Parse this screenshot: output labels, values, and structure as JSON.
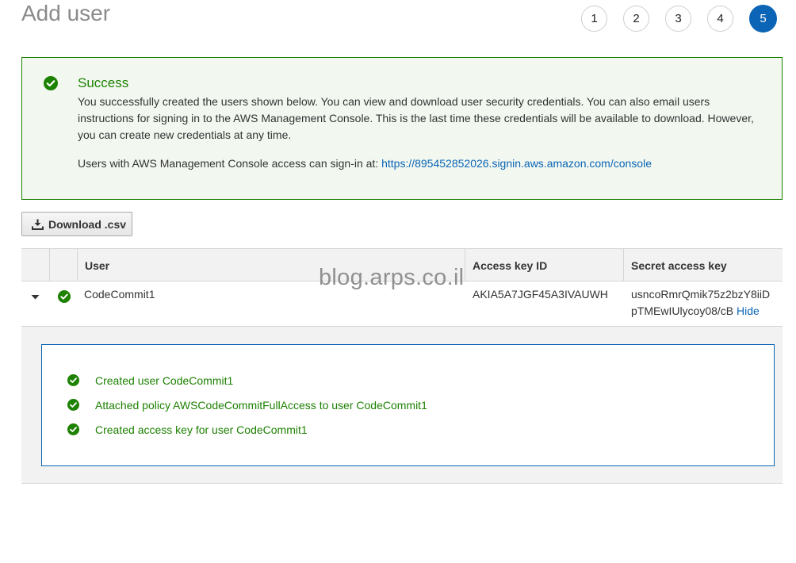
{
  "page": {
    "title": "Add user"
  },
  "steps": [
    {
      "label": "1",
      "active": false
    },
    {
      "label": "2",
      "active": false
    },
    {
      "label": "3",
      "active": false
    },
    {
      "label": "4",
      "active": false
    },
    {
      "label": "5",
      "active": true
    }
  ],
  "success": {
    "title": "Success",
    "message": "You successfully created the users shown below. You can view and download user security credentials. You can also email users instructions for signing in to the AWS Management Console. This is the last time these credentials will be available to download. However, you can create new credentials at any time.",
    "signin_prefix": "Users with AWS Management Console access can sign-in at:",
    "signin_url": "https://895452852026.signin.aws.amazon.com/console"
  },
  "toolbar": {
    "download_label": "Download .csv"
  },
  "table": {
    "headers": {
      "user": "User",
      "access_key_id": "Access key ID",
      "secret_access_key": "Secret access key"
    },
    "rows": [
      {
        "user": "CodeCommit1",
        "access_key_id": "AKIA5A7JGF45A3IVAUWH",
        "secret_line1": "usncoRmrQmik75z2bzY8iiD",
        "secret_line2": "pTMEwIUlycoy08/cB",
        "hide_label": "Hide",
        "details": [
          "Created user CodeCommit1",
          "Attached policy AWSCodeCommitFullAccess to user CodeCommit1",
          "Created access key for user CodeCommit1"
        ]
      }
    ]
  },
  "watermark": "blog.arps.co.il",
  "colors": {
    "success_green": "#1d8102",
    "link_blue": "#0b64b5",
    "active_step": "#0b64b5"
  }
}
